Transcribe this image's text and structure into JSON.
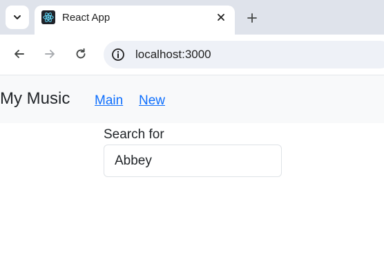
{
  "browser": {
    "tab": {
      "title": "React App",
      "favicon": "react-logo-icon"
    },
    "address_bar": {
      "url": "localhost:3000"
    },
    "icons": {
      "tab_search": "chevron-down-icon",
      "close": "close-icon",
      "new_tab": "plus-icon",
      "back": "arrow-left-icon",
      "forward": "arrow-right-icon",
      "reload": "reload-icon",
      "site_info": "info-icon"
    }
  },
  "app": {
    "brand": "My Music",
    "nav_links": [
      {
        "label": "Main"
      },
      {
        "label": "New"
      }
    ],
    "search": {
      "label": "Search for",
      "value": "Abbey"
    }
  },
  "colors": {
    "link": "#0d6efd",
    "navbar_bg": "#f8f9fa",
    "tabstrip_bg": "#dfe3eb"
  }
}
